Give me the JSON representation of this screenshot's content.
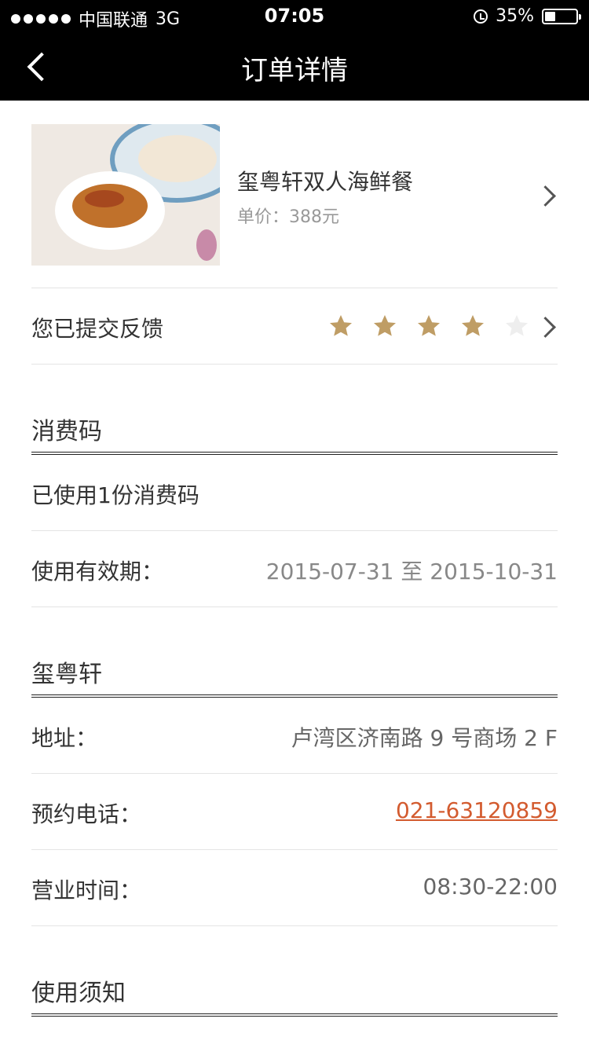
{
  "status": {
    "carrier": "中国联通",
    "network": "3G",
    "time": "07:05",
    "battery_text": "35%",
    "battery_level": 0.35
  },
  "nav": {
    "title": "订单详情"
  },
  "product": {
    "name": "玺粤轩双人海鲜餐",
    "price": "单价：388元",
    "image_icon": "food-photo"
  },
  "feedback": {
    "label": "您已提交反馈",
    "rating": 4,
    "max": 5,
    "star_color": "#bf9d65",
    "star_empty_color": "#eeeeee"
  },
  "code": {
    "title": "消费码",
    "used": "已使用1份消费码",
    "validity_label": "使用有效期：",
    "validity_value": "2015-07-31 至 2015-10-31"
  },
  "store": {
    "title": "玺粤轩",
    "address_label": "地址：",
    "address_value": "卢湾区济南路 9 号商场 2 F",
    "phone_label": "预约电话：",
    "phone_value": "021-63120859",
    "hours_label": "营业时间：",
    "hours_value": "08:30-22:00"
  },
  "notice": {
    "title": "使用须知"
  },
  "colors": {
    "accent_link": "#d35b2f",
    "bar": "#000000"
  }
}
